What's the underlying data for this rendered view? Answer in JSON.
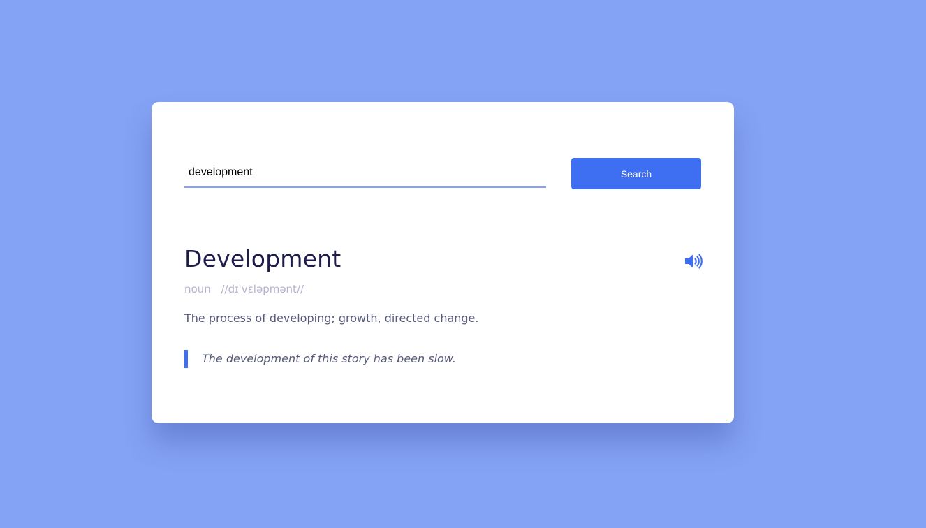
{
  "search": {
    "value": "development",
    "button_label": "Search"
  },
  "result": {
    "word": "Development",
    "part_of_speech": "noun",
    "phonetic": "//dɪˈvɛləpmənt//",
    "definition": "The process of developing; growth, directed change.",
    "example": "The development of this story has been slow."
  },
  "icons": {
    "pronounce": "speaker-volume-icon"
  },
  "colors": {
    "background": "#85a3f5",
    "accent": "#3e6ff2",
    "title": "#1e1c4c",
    "muted": "#b4b4cf",
    "body_text": "#575a7b"
  }
}
